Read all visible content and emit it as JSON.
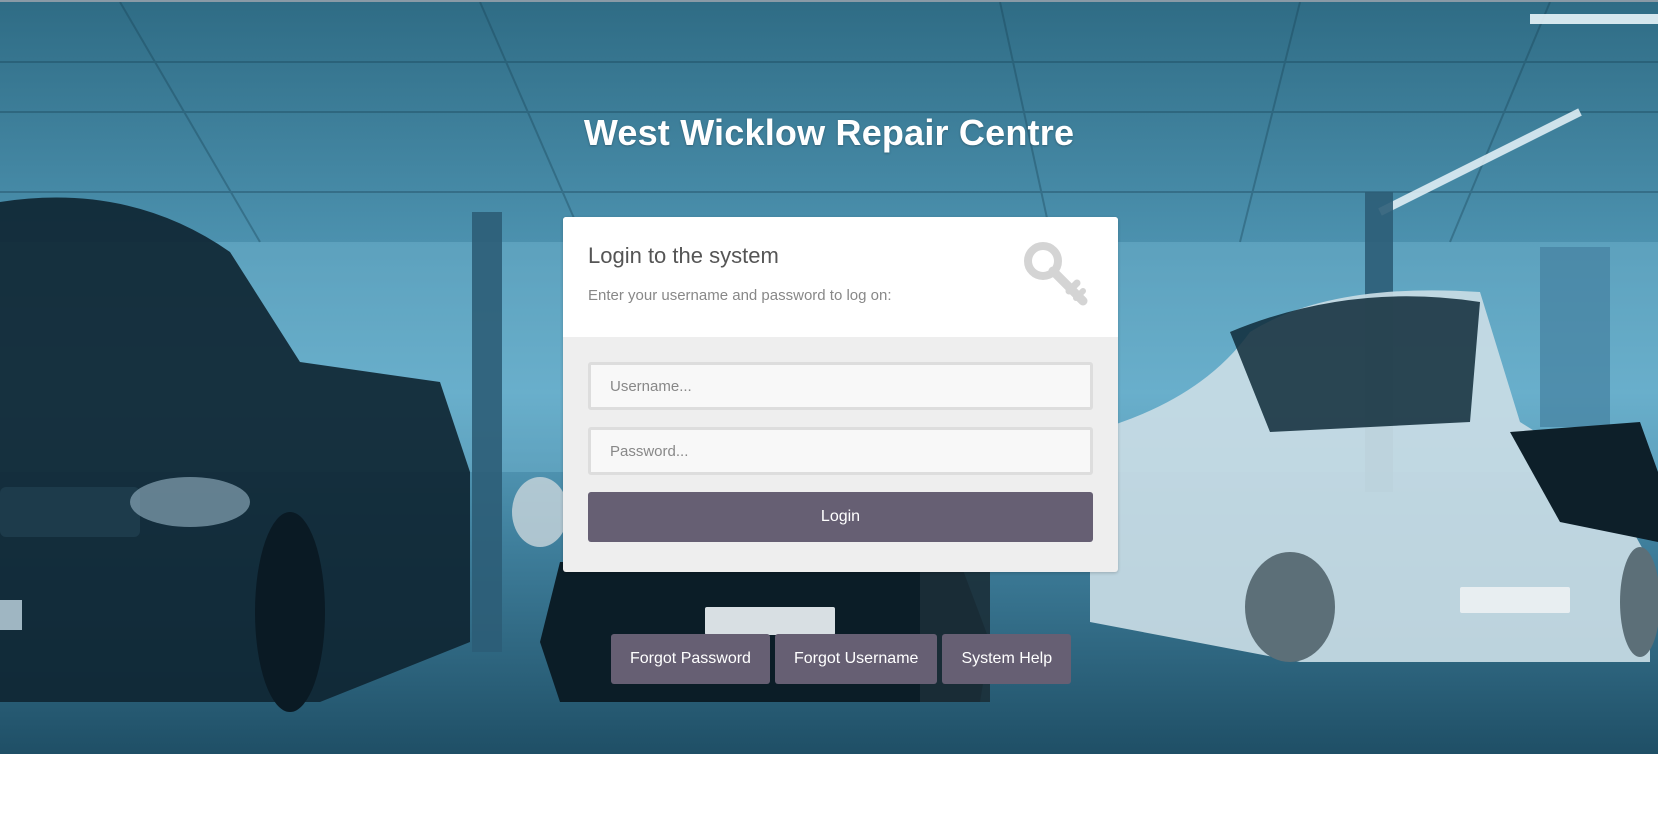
{
  "page": {
    "title": "West Wicklow Repair Centre"
  },
  "login": {
    "heading": "Login to the system",
    "instructions": "Enter your username and password to log on:",
    "username_placeholder": "Username...",
    "password_placeholder": "Password...",
    "submit_label": "Login",
    "icon": "key-icon"
  },
  "links": {
    "forgot_password": "Forgot Password",
    "forgot_username": "Forgot Username",
    "system_help": "System Help"
  },
  "colors": {
    "button": "#665f73",
    "card_body": "#eeeeee",
    "hero_tint": "#3f7f9c"
  }
}
